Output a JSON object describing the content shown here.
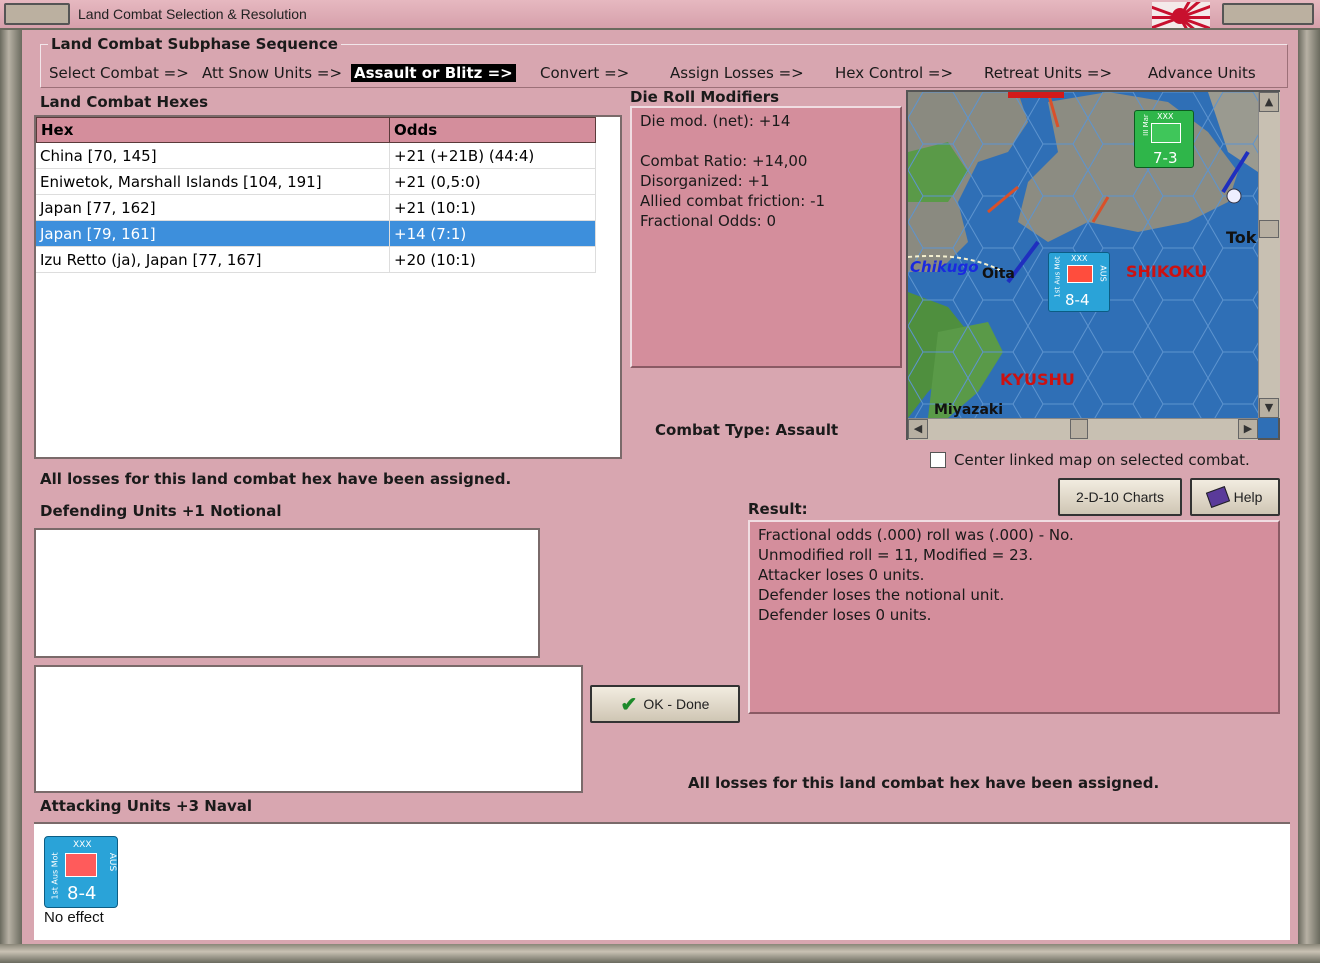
{
  "window": {
    "title": "Land Combat Selection & Resolution"
  },
  "sequence": {
    "title": "Land Combat Subphase Sequence",
    "steps": [
      "Select Combat =>",
      "Att Snow Units =>",
      "Assault or Blitz =>",
      "Convert =>",
      "Assign Losses =>",
      "Hex Control =>",
      "Retreat Units =>",
      "Advance Units"
    ],
    "active_index": 2
  },
  "hexes": {
    "label": "Land Combat Hexes",
    "columns": [
      "Hex",
      "Odds"
    ],
    "rows": [
      {
        "hex": "China [70, 145]",
        "odds": "+21 (+21B) (44:4)"
      },
      {
        "hex": "Eniwetok, Marshall Islands [104, 191]",
        "odds": "+21 (0,5:0)"
      },
      {
        "hex": "Japan [77, 162]",
        "odds": "+21 (10:1)"
      },
      {
        "hex": "Japan [79, 161]",
        "odds": "+14 (7:1)"
      },
      {
        "hex": "Izu Retto (ja), Japan [77, 167]",
        "odds": "+20 (10:1)"
      }
    ],
    "selected_index": 3
  },
  "die_roll": {
    "label": "Die Roll Modifiers",
    "lines": [
      "Die mod. (net): +14",
      "",
      "Combat Ratio: +14,00",
      "Disorganized: +1",
      "Allied combat friction: -1",
      "Fractional Odds: 0"
    ]
  },
  "combat_type": "Combat Type:  Assault",
  "map": {
    "labels": [
      "Chikugo",
      "Oita",
      "SHIKOKU",
      "KYUSHU",
      "Miyazaki",
      "Tok"
    ],
    "counter_top_value": "7-3",
    "counter_top_size": "XXX",
    "counter_top_name": "III Mar",
    "counter_mid_value": "8-4",
    "counter_mid_size": "XXX",
    "counter_mid_name": "1st Aus Mot",
    "counter_mid_nation": "AUS"
  },
  "center_map_checkbox": {
    "label": "Center linked map on selected combat.",
    "checked": false
  },
  "losses_msg_top": "All losses for this land combat hex have been assigned.",
  "defending": {
    "label": "Defending Units +1 Notional"
  },
  "charts_button": "2-D-10 Charts",
  "help_button": "Help",
  "result": {
    "label": "Result:",
    "lines": [
      "Fractional odds (.000) roll was (.000)  - No.",
      "Unmodified roll = 11, Modified = 23.",
      "Attacker loses 0 units.",
      "Defender loses the notional unit.",
      "Defender loses 0 units."
    ]
  },
  "ok_button": "OK - Done",
  "losses_msg_bottom": "All losses for this land combat hex have been assigned.",
  "attacking": {
    "label": "Attacking Units +3 Naval",
    "unit": {
      "name": "1st Aus Mot",
      "nation": "AUS",
      "size": "XXX",
      "value": "8-4",
      "status": "No effect"
    }
  },
  "colors": {
    "panel_pink": "#d8a6b0",
    "header_pink": "#d48e9c",
    "selection_blue": "#3d8fdc",
    "counter_blue": "#2aa3d8",
    "counter_green": "#2fb64a"
  }
}
